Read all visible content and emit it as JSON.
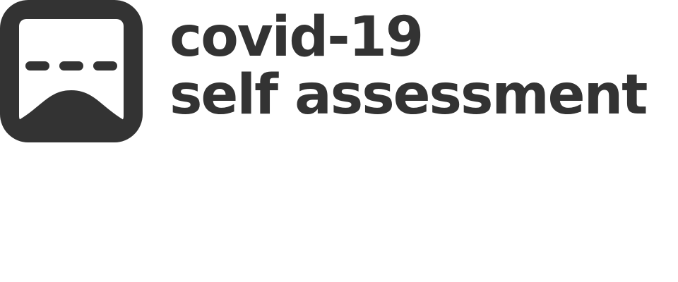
{
  "logo": {
    "icon": "curve-chart-icon",
    "line1": "covid-19",
    "line2": "self assessment",
    "color": "#333333"
  }
}
